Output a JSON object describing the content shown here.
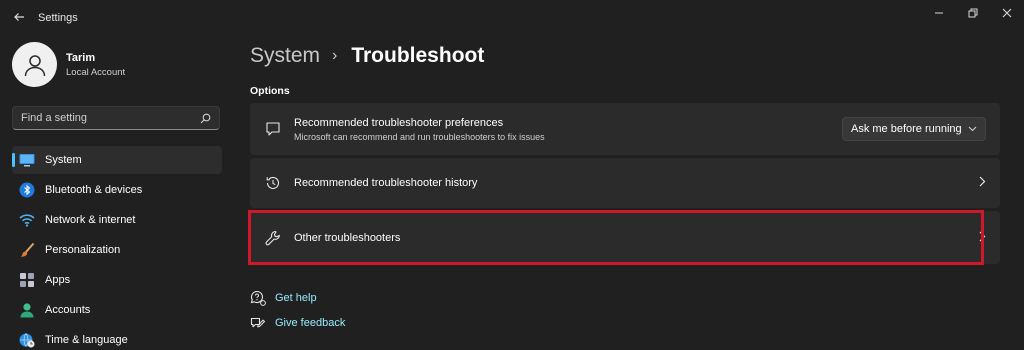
{
  "app": {
    "title": "Settings"
  },
  "profile": {
    "name": "Tarim",
    "account_type": "Local Account"
  },
  "search": {
    "placeholder": "Find a setting"
  },
  "sidebar": {
    "items": [
      {
        "label": "System",
        "icon": "system-monitor-icon",
        "active": true
      },
      {
        "label": "Bluetooth & devices",
        "icon": "bluetooth-icon"
      },
      {
        "label": "Network & internet",
        "icon": "wifi-icon"
      },
      {
        "label": "Personalization",
        "icon": "brush-icon"
      },
      {
        "label": "Apps",
        "icon": "apps-icon"
      },
      {
        "label": "Accounts",
        "icon": "accounts-icon"
      },
      {
        "label": "Time & language",
        "icon": "globe-clock-icon"
      }
    ]
  },
  "breadcrumb": {
    "parent": "System",
    "separator": "›",
    "current": "Troubleshoot"
  },
  "main": {
    "section_label": "Options",
    "cards": [
      {
        "title": "Recommended troubleshooter preferences",
        "description": "Microsoft can recommend and run troubleshooters to fix issues",
        "icon": "chat-bubble-icon",
        "dropdown_value": "Ask me before running"
      },
      {
        "title": "Recommended troubleshooter history",
        "icon": "history-icon"
      },
      {
        "title": "Other troubleshooters",
        "icon": "wrench-icon"
      }
    ]
  },
  "links": {
    "help": "Get help",
    "feedback": "Give feedback"
  },
  "colors": {
    "background": "#202020",
    "card": "#2b2b2b",
    "accent": "#4cc2ff",
    "link": "#99ebff",
    "highlight": "#d0182b"
  }
}
